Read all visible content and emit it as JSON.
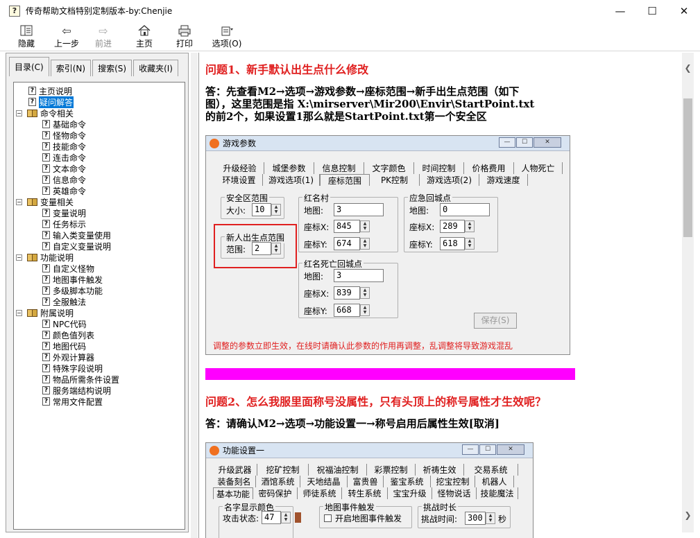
{
  "window": {
    "title": "传奇帮助文档特别定制版本-by:Chenjie",
    "min": "—",
    "max": "☐",
    "close": "✕"
  },
  "toolbar": {
    "hide": "隐藏",
    "back": "上一步",
    "forward": "前进",
    "home": "主页",
    "print": "打印",
    "options": "选项(O)"
  },
  "tabs": [
    "目录(C)",
    "索引(N)",
    "搜索(S)",
    "收藏夹(I)"
  ],
  "tree": [
    {
      "label": "主页说明",
      "type": "page",
      "level": 1
    },
    {
      "label": "疑问解答",
      "type": "page",
      "level": 1,
      "selected": true
    },
    {
      "label": "命令相关",
      "type": "book",
      "level": 0
    },
    {
      "label": "基础命令",
      "type": "page",
      "level": 2
    },
    {
      "label": "怪物命令",
      "type": "page",
      "level": 2
    },
    {
      "label": "技能命令",
      "type": "page",
      "level": 2
    },
    {
      "label": "连击命令",
      "type": "page",
      "level": 2
    },
    {
      "label": "文本命令",
      "type": "page",
      "level": 2
    },
    {
      "label": "信息命令",
      "type": "page",
      "level": 2
    },
    {
      "label": "英雄命令",
      "type": "page",
      "level": 2
    },
    {
      "label": "变量相关",
      "type": "book",
      "level": 0
    },
    {
      "label": "变量说明",
      "type": "page",
      "level": 2
    },
    {
      "label": "任务标示",
      "type": "page",
      "level": 2
    },
    {
      "label": "输入类变量使用",
      "type": "page",
      "level": 2
    },
    {
      "label": "自定义变量说明",
      "type": "page",
      "level": 2
    },
    {
      "label": "功能说明",
      "type": "book",
      "level": 0
    },
    {
      "label": "自定义怪物",
      "type": "page",
      "level": 2
    },
    {
      "label": "地图事件触发",
      "type": "page",
      "level": 2
    },
    {
      "label": "多级脚本功能",
      "type": "page",
      "level": 2
    },
    {
      "label": "全服触法",
      "type": "page",
      "level": 2
    },
    {
      "label": "附属说明",
      "type": "book",
      "level": 0
    },
    {
      "label": "NPC代码",
      "type": "page",
      "level": 2
    },
    {
      "label": "颜色值列表",
      "type": "page",
      "level": 2
    },
    {
      "label": "地图代码",
      "type": "page",
      "level": 2
    },
    {
      "label": "外观计算器",
      "type": "page",
      "level": 2
    },
    {
      "label": "特殊字段说明",
      "type": "page",
      "level": 2
    },
    {
      "label": "物品所需条件设置",
      "type": "page",
      "level": 2
    },
    {
      "label": "服务端结构说明",
      "type": "page",
      "level": 2
    },
    {
      "label": "常用文件配置",
      "type": "page",
      "level": 2
    }
  ],
  "content": {
    "q1": "问题1、新手默认出生点什么修改",
    "a1_lines": [
      "答：先查看M2→选项→游戏参数→座标范围→新手出生点范围（如下",
      "图），这里范围是指 X:\\mirserver\\Mir200\\Envir\\StartPoint.txt",
      "的前2个，如果设置1那么就是StartPoint.txt第一个安全区"
    ],
    "q2": "问题2、怎么我服里面称号没属性，只有头顶上的称号属性才生效呢？",
    "a2": "答：请确认M2→选项→功能设置一→称号启用后属性生效[取消]"
  },
  "dlg1": {
    "title": "游戏参数",
    "tabs_row1": [
      "升级经验",
      "城堡参数",
      "信息控制",
      "文字颜色",
      "时间控制",
      "价格费用",
      "人物死亡"
    ],
    "tabs_row2": [
      "环境设置",
      "游戏选项(1)",
      "座标范围",
      "PK控制",
      "游戏选项(2)",
      "游戏速度"
    ],
    "safe_zone": {
      "title": "安全区范围",
      "label": "大小:",
      "value": "10"
    },
    "newbie": {
      "title": "新人出生点范围",
      "label": "范围:",
      "value": "2"
    },
    "redname_village": {
      "title": "红名村",
      "map_label": "地图:",
      "map": "3",
      "x_label": "座标X:",
      "x": "845",
      "y_label": "座标Y:",
      "y": "674"
    },
    "emergency": {
      "title": "应急回城点",
      "map_label": "地图:",
      "map": "0",
      "x_label": "座标X:",
      "x": "289",
      "y_label": "座标Y:",
      "y": "618"
    },
    "redname_death": {
      "title": "红名死亡回城点",
      "map_label": "地图:",
      "map": "3",
      "x_label": "座标X:",
      "x": "839",
      "y_label": "座标Y:",
      "y": "668"
    },
    "save": "保存(S)",
    "warning": "调整的参数立即生效，在线时请确认此参数的作用再调整，乱调整将导致游戏混乱"
  },
  "dlg2": {
    "title": "功能设置一",
    "tabs_row1": [
      "升级武器",
      "挖矿控制",
      "祝福油控制",
      "彩票控制",
      "祈祷生效",
      "交易系统"
    ],
    "tabs_row2": [
      "装备刻名",
      "酒馆系统",
      "天地结晶",
      "富贵兽",
      "鉴宝系统",
      "挖宝控制",
      "机器人"
    ],
    "tabs_row3": [
      "基本功能",
      "密码保护",
      "师徒系统",
      "转生系统",
      "宝宝升级",
      "怪物说话",
      "技能魔法"
    ],
    "name_color": {
      "title": "名字显示颜色",
      "label": "攻击状态:",
      "value": "47",
      "color": "#a0522d"
    },
    "map_event": {
      "title": "地图事件触发",
      "check": "开启地图事件触发"
    },
    "challenge": {
      "title": "挑战时长",
      "label": "挑战时间:",
      "value": "300",
      "unit": "秒"
    }
  },
  "colors": {
    "question": "#e02020",
    "divider": "#ff00ff",
    "selection": "#0078d7",
    "highlight_box": "#e02020"
  }
}
